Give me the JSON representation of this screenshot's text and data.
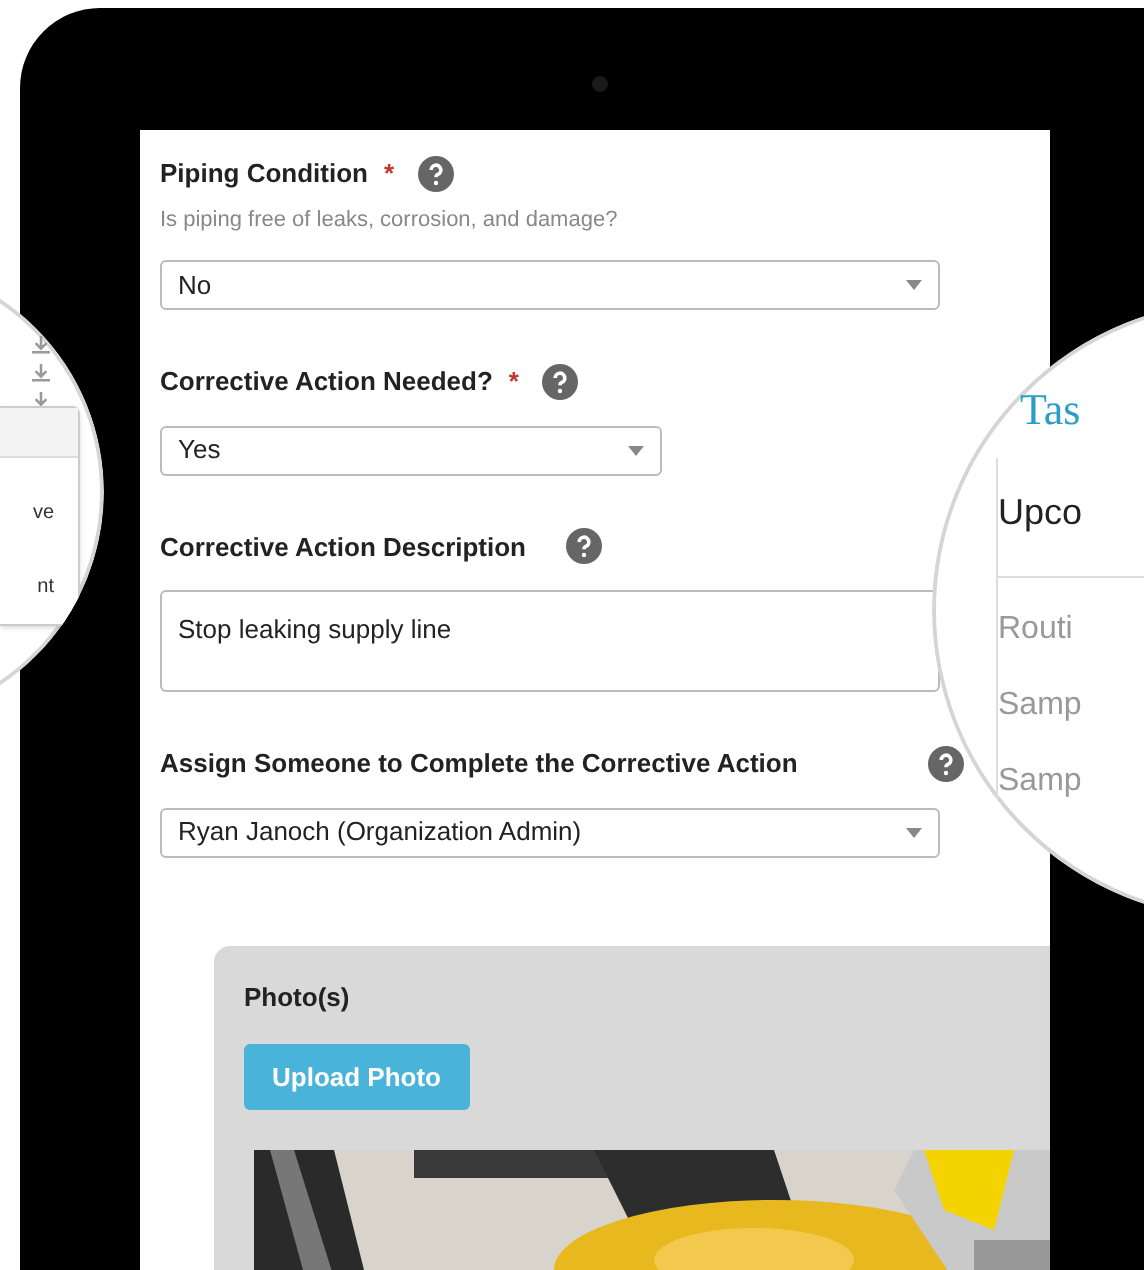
{
  "form": {
    "fields": [
      {
        "kind": "select",
        "label": "Piping Condition",
        "required_mark": "*",
        "help": "Is piping free of leaks, corrosion, and damage?",
        "value": "No"
      },
      {
        "kind": "select",
        "label": "Corrective Action Needed?",
        "required_mark": "*",
        "value": "Yes"
      },
      {
        "kind": "textarea",
        "label": "Corrective Action Description",
        "value": "Stop leaking supply line"
      },
      {
        "kind": "select",
        "label": "Assign Someone to Complete the Corrective Action",
        "value": "Ryan Janoch (Organization Admin)"
      }
    ]
  },
  "photos": {
    "title": "Photo(s)",
    "button": "Upload Photo"
  },
  "left_magnifier": {
    "items": [
      "ve",
      "nt"
    ]
  },
  "right_magnifier": {
    "title": "Tas",
    "heading": "Upco",
    "items": [
      "Routi",
      "Samp",
      "Samp"
    ]
  }
}
